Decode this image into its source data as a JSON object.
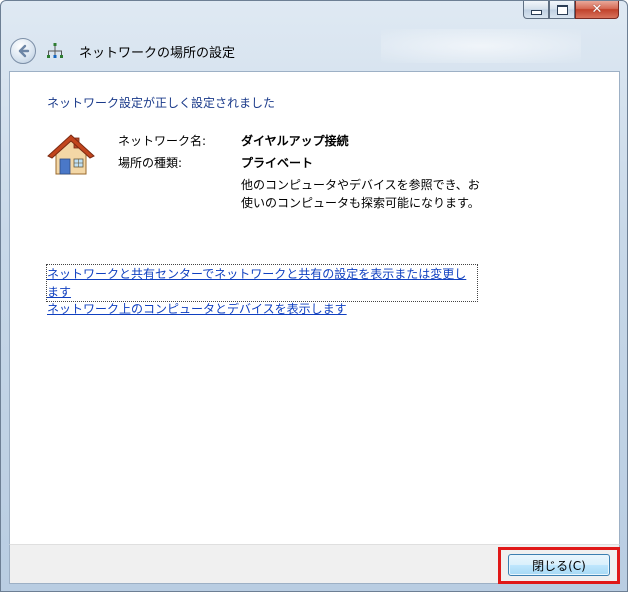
{
  "window": {
    "title": "ネットワークの場所の設定",
    "caption_buttons": {
      "minimize_icon": "minimize-icon",
      "maximize_icon": "maximize-icon",
      "close_glyph": "✕"
    }
  },
  "main": {
    "heading": "ネットワーク設定が正しく設定されました",
    "network_name_label": "ネットワーク名:",
    "network_name_value": "ダイヤルアップ接続",
    "location_type_label": "場所の種類:",
    "location_type_value": "プライベート",
    "description": "他のコンピュータやデバイスを参照でき、お使いのコンピュータも探索可能になります。",
    "link_network_center": "ネットワークと共有センターでネットワークと共有の設定を表示または変更します",
    "link_view_devices": "ネットワーク上のコンピュータとデバイスを表示します"
  },
  "footer": {
    "close_label": "閉じる(C)"
  },
  "colors": {
    "heading": "#1a3a8a",
    "link": "#1040c0",
    "highlight": "#e01818"
  }
}
